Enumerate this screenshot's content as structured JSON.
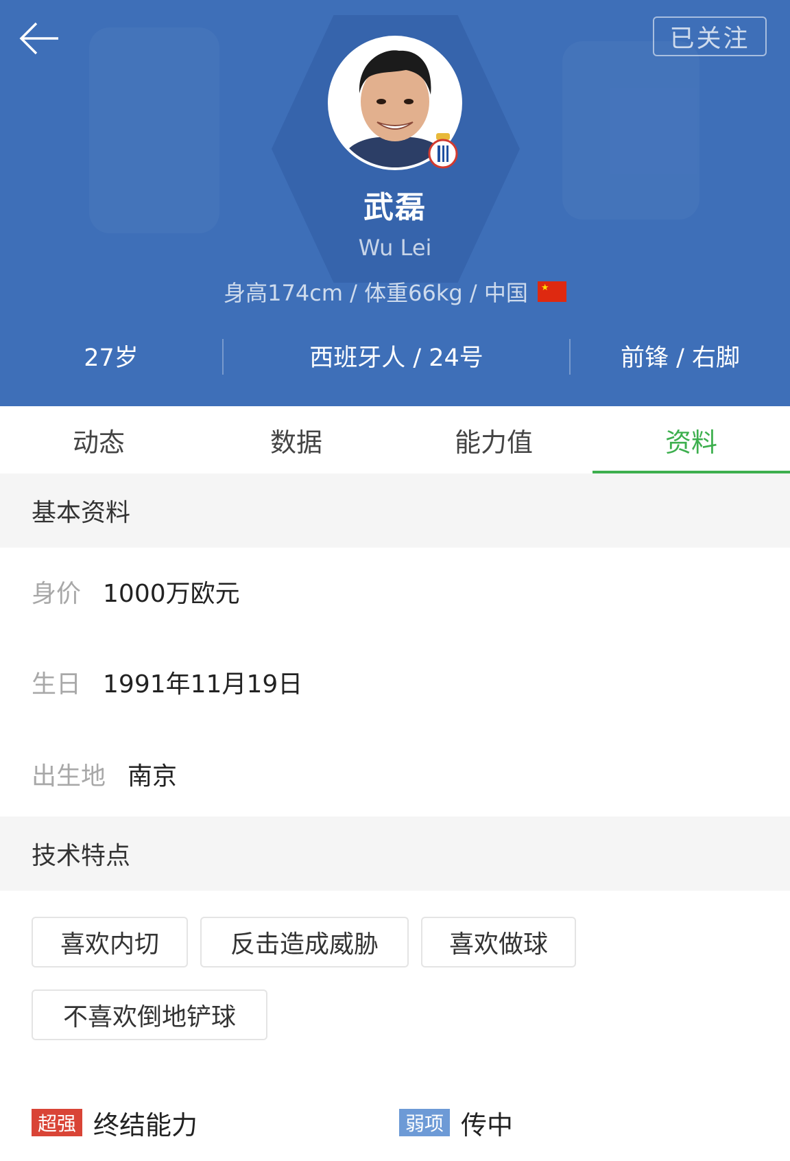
{
  "header": {
    "follow_label": "已关注",
    "name_cn": "武磊",
    "name_en": "Wu Lei",
    "bio": "身高174cm / 体重66kg / 中国",
    "stats": {
      "age": "27岁",
      "club": "西班牙人 / 24号",
      "position": "前锋 / 右脚"
    }
  },
  "tabs": [
    {
      "label": "动态"
    },
    {
      "label": "数据"
    },
    {
      "label": "能力值"
    },
    {
      "label": "资料"
    }
  ],
  "active_tab": "资料",
  "colors": {
    "header_bg": "#3e6fb8",
    "accent": "#3daf4e",
    "strong_badge": "#d94436",
    "weak_badge": "#6d9ad6"
  },
  "basic_info": {
    "title": "基本资料",
    "rows": [
      {
        "label": "身价",
        "value": "1000万欧元"
      },
      {
        "label": "生日",
        "value": "1991年11月19日"
      },
      {
        "label": "出生地",
        "value": "南京"
      }
    ]
  },
  "skills": {
    "title": "技术特点",
    "tags": [
      "喜欢内切",
      "反击造成威胁",
      "喜欢做球",
      "不喜欢倒地铲球"
    ],
    "strength": {
      "badge": "超强",
      "text": "终结能力"
    },
    "weakness": {
      "badge": "弱项",
      "text": "传中"
    }
  }
}
